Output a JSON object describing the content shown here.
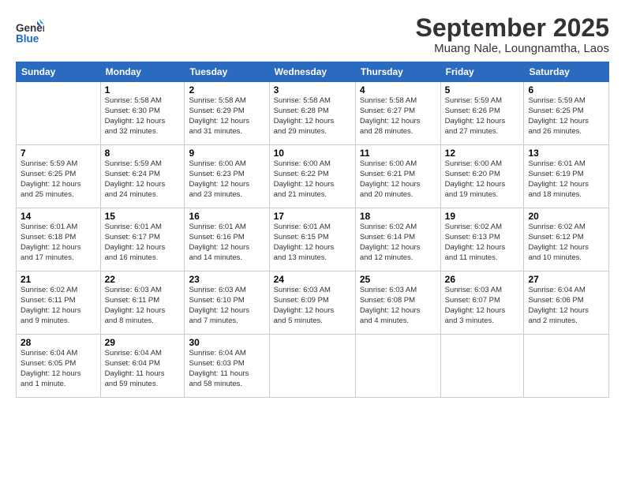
{
  "header": {
    "logo_general": "General",
    "logo_blue": "Blue",
    "month_title": "September 2025",
    "subtitle": "Muang Nale, Loungnamtha, Laos"
  },
  "weekdays": [
    "Sunday",
    "Monday",
    "Tuesday",
    "Wednesday",
    "Thursday",
    "Friday",
    "Saturday"
  ],
  "weeks": [
    [
      {
        "day": "",
        "detail": ""
      },
      {
        "day": "1",
        "detail": "Sunrise: 5:58 AM\nSunset: 6:30 PM\nDaylight: 12 hours\nand 32 minutes."
      },
      {
        "day": "2",
        "detail": "Sunrise: 5:58 AM\nSunset: 6:29 PM\nDaylight: 12 hours\nand 31 minutes."
      },
      {
        "day": "3",
        "detail": "Sunrise: 5:58 AM\nSunset: 6:28 PM\nDaylight: 12 hours\nand 29 minutes."
      },
      {
        "day": "4",
        "detail": "Sunrise: 5:58 AM\nSunset: 6:27 PM\nDaylight: 12 hours\nand 28 minutes."
      },
      {
        "day": "5",
        "detail": "Sunrise: 5:59 AM\nSunset: 6:26 PM\nDaylight: 12 hours\nand 27 minutes."
      },
      {
        "day": "6",
        "detail": "Sunrise: 5:59 AM\nSunset: 6:25 PM\nDaylight: 12 hours\nand 26 minutes."
      }
    ],
    [
      {
        "day": "7",
        "detail": "Sunrise: 5:59 AM\nSunset: 6:25 PM\nDaylight: 12 hours\nand 25 minutes."
      },
      {
        "day": "8",
        "detail": "Sunrise: 5:59 AM\nSunset: 6:24 PM\nDaylight: 12 hours\nand 24 minutes."
      },
      {
        "day": "9",
        "detail": "Sunrise: 6:00 AM\nSunset: 6:23 PM\nDaylight: 12 hours\nand 23 minutes."
      },
      {
        "day": "10",
        "detail": "Sunrise: 6:00 AM\nSunset: 6:22 PM\nDaylight: 12 hours\nand 21 minutes."
      },
      {
        "day": "11",
        "detail": "Sunrise: 6:00 AM\nSunset: 6:21 PM\nDaylight: 12 hours\nand 20 minutes."
      },
      {
        "day": "12",
        "detail": "Sunrise: 6:00 AM\nSunset: 6:20 PM\nDaylight: 12 hours\nand 19 minutes."
      },
      {
        "day": "13",
        "detail": "Sunrise: 6:01 AM\nSunset: 6:19 PM\nDaylight: 12 hours\nand 18 minutes."
      }
    ],
    [
      {
        "day": "14",
        "detail": "Sunrise: 6:01 AM\nSunset: 6:18 PM\nDaylight: 12 hours\nand 17 minutes."
      },
      {
        "day": "15",
        "detail": "Sunrise: 6:01 AM\nSunset: 6:17 PM\nDaylight: 12 hours\nand 16 minutes."
      },
      {
        "day": "16",
        "detail": "Sunrise: 6:01 AM\nSunset: 6:16 PM\nDaylight: 12 hours\nand 14 minutes."
      },
      {
        "day": "17",
        "detail": "Sunrise: 6:01 AM\nSunset: 6:15 PM\nDaylight: 12 hours\nand 13 minutes."
      },
      {
        "day": "18",
        "detail": "Sunrise: 6:02 AM\nSunset: 6:14 PM\nDaylight: 12 hours\nand 12 minutes."
      },
      {
        "day": "19",
        "detail": "Sunrise: 6:02 AM\nSunset: 6:13 PM\nDaylight: 12 hours\nand 11 minutes."
      },
      {
        "day": "20",
        "detail": "Sunrise: 6:02 AM\nSunset: 6:12 PM\nDaylight: 12 hours\nand 10 minutes."
      }
    ],
    [
      {
        "day": "21",
        "detail": "Sunrise: 6:02 AM\nSunset: 6:11 PM\nDaylight: 12 hours\nand 9 minutes."
      },
      {
        "day": "22",
        "detail": "Sunrise: 6:03 AM\nSunset: 6:11 PM\nDaylight: 12 hours\nand 8 minutes."
      },
      {
        "day": "23",
        "detail": "Sunrise: 6:03 AM\nSunset: 6:10 PM\nDaylight: 12 hours\nand 7 minutes."
      },
      {
        "day": "24",
        "detail": "Sunrise: 6:03 AM\nSunset: 6:09 PM\nDaylight: 12 hours\nand 5 minutes."
      },
      {
        "day": "25",
        "detail": "Sunrise: 6:03 AM\nSunset: 6:08 PM\nDaylight: 12 hours\nand 4 minutes."
      },
      {
        "day": "26",
        "detail": "Sunrise: 6:03 AM\nSunset: 6:07 PM\nDaylight: 12 hours\nand 3 minutes."
      },
      {
        "day": "27",
        "detail": "Sunrise: 6:04 AM\nSunset: 6:06 PM\nDaylight: 12 hours\nand 2 minutes."
      }
    ],
    [
      {
        "day": "28",
        "detail": "Sunrise: 6:04 AM\nSunset: 6:05 PM\nDaylight: 12 hours\nand 1 minute."
      },
      {
        "day": "29",
        "detail": "Sunrise: 6:04 AM\nSunset: 6:04 PM\nDaylight: 11 hours\nand 59 minutes."
      },
      {
        "day": "30",
        "detail": "Sunrise: 6:04 AM\nSunset: 6:03 PM\nDaylight: 11 hours\nand 58 minutes."
      },
      {
        "day": "",
        "detail": ""
      },
      {
        "day": "",
        "detail": ""
      },
      {
        "day": "",
        "detail": ""
      },
      {
        "day": "",
        "detail": ""
      }
    ]
  ]
}
